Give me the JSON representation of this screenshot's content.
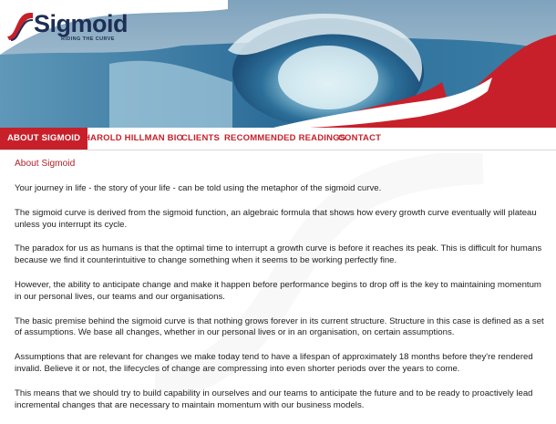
{
  "header": {
    "logo_word": "Sigmoid",
    "logo_tagline": "RIDING THE CURVE",
    "colors": {
      "brand_red": "#c8202a",
      "navy": "#1e2f55",
      "wave_blue": "#2f74a2"
    }
  },
  "nav": {
    "items": [
      {
        "label": "ABOUT SIGMOID",
        "active": true
      },
      {
        "label": "HAROLD HILLMAN BIO",
        "active": false
      },
      {
        "label": "CLIENTS",
        "active": false
      },
      {
        "label": "RECOMMENDED READINGS",
        "active": false
      },
      {
        "label": "CONTACT",
        "active": false
      }
    ]
  },
  "main": {
    "heading": "About Sigmoid",
    "paragraphs": [
      "Your journey in life - the story of your life - can be told using the metaphor of the sigmoid curve.",
      "The sigmoid curve is derived from the sigmoid function, an algebraic formula that shows how every growth curve eventually will plateau unless you interrupt its cycle.",
      "The paradox for us as humans is that the optimal time to interrupt a growth curve is before it reaches its peak. This is difficult for humans because we find it counterintuitive to change something when it seems to be working perfectly fine.",
      "However, the ability to anticipate change and make it happen before performance begins to drop off is the key to maintaining momentum in our personal lives, our teams and our organisations.",
      "The basic premise behind the sigmoid curve is that nothing grows forever in its current structure. Structure in this case is defined as a set of assumptions. We base all changes, whether in our personal lives or in an organisation, on certain assumptions.",
      "Assumptions that are relevant for changes we make today tend to have a lifespan of approximately 18 months before they're rendered invalid. Believe it or not, the lifecycles of change are compressing into even shorter periods over the years to come.",
      "This means that we should try to build capability in ourselves and our teams to anticipate the future and to be ready to proactively lead incremental changes that are necessary to maintain momentum with our business models."
    ]
  }
}
